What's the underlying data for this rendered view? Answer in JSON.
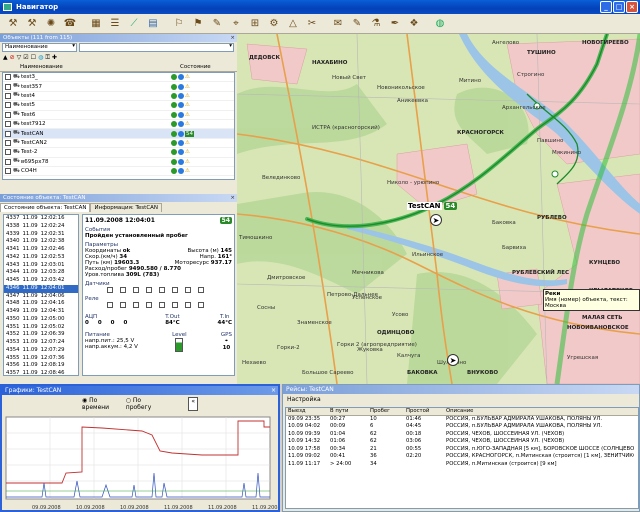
{
  "window": {
    "title": "Навигатор"
  },
  "objects_panel": {
    "title": "Объекты (111 from 115)",
    "filter_field": "Наименование",
    "col_name": "Наименование",
    "col_state": "Состояние",
    "rows": [
      {
        "name": "test3_",
        "state": "green-yellow"
      },
      {
        "name": "test357",
        "state": "green-yellow"
      },
      {
        "name": "test4",
        "state": "green-yellow"
      },
      {
        "name": "test5",
        "state": "green-yellow"
      },
      {
        "name": "Test6",
        "state": "green-yellow"
      },
      {
        "name": "test7912",
        "state": "green-yellow"
      },
      {
        "name": "TestCAN",
        "state": "green-54"
      },
      {
        "name": "TestCAN2",
        "state": "green-yellow"
      },
      {
        "name": "Test-2",
        "state": "green-yellow"
      },
      {
        "name": "в695рх78",
        "state": "green-yellow"
      },
      {
        "name": "CO4H",
        "state": "green-yellow"
      }
    ]
  },
  "state_panel": {
    "title": "Состояние объекта: TestCAN",
    "tab_state": "Состояние объекта: TestCAN",
    "tab_info": "Информация: TestCAN",
    "timestamp": "11.09.2008 12:04:01",
    "badge": "54",
    "events": [
      {
        "id": "4337",
        "date": "11.09",
        "time": "12:02:16"
      },
      {
        "id": "4338",
        "date": "11.09",
        "time": "12:02:24"
      },
      {
        "id": "4339",
        "date": "11.09",
        "time": "12:02:31"
      },
      {
        "id": "4340",
        "date": "11.09",
        "time": "12:02:38"
      },
      {
        "id": "4341",
        "date": "11.09",
        "time": "12:02:46"
      },
      {
        "id": "4342",
        "date": "11.09",
        "time": "12:02:53"
      },
      {
        "id": "4343",
        "date": "11.09",
        "time": "12:03:01"
      },
      {
        "id": "4344",
        "date": "11.09",
        "time": "12:03:28"
      },
      {
        "id": "4345",
        "date": "11.09",
        "time": "12:03:42"
      },
      {
        "id": "4346",
        "date": "11.09",
        "time": "12:04:01"
      },
      {
        "id": "4347",
        "date": "11.09",
        "time": "12:04:06"
      },
      {
        "id": "4348",
        "date": "11.09",
        "time": "12:04:16"
      },
      {
        "id": "4349",
        "date": "11.09",
        "time": "12:04:31"
      },
      {
        "id": "4350",
        "date": "11.09",
        "time": "12:05:00"
      },
      {
        "id": "4351",
        "date": "11.09",
        "time": "12:05:02"
      },
      {
        "id": "4352",
        "date": "11.09",
        "time": "12:06:39"
      },
      {
        "id": "4353",
        "date": "11.09",
        "time": "12:07:24"
      },
      {
        "id": "4354",
        "date": "11.09",
        "time": "12:07:29"
      },
      {
        "id": "4355",
        "date": "11.09",
        "time": "12:07:36"
      },
      {
        "id": "4356",
        "date": "11.09",
        "time": "12:08:19"
      },
      {
        "id": "4357",
        "date": "11.09",
        "time": "12:08:46"
      }
    ],
    "event_label": "События",
    "event_value": "Пройден установленный пробег",
    "params_label": "Параметры",
    "coords_label": "Координаты",
    "coords_value": "ok",
    "height_label": "Высота (м)",
    "height_value": "145",
    "speed_label": "Скор.(км/ч)",
    "speed_value": "34",
    "dir_label": "Напр.",
    "dir_value": "161°",
    "path_label": "Путь (км)",
    "path_value": "19603.3",
    "motor_label": "Моторесурс",
    "motor_value": "937.17",
    "fuel_label": "Расход/пробег",
    "fuel_value": "9490.580 / 8.770",
    "fuel_level_label": "Уров.топлива",
    "fuel_level_value": "309L (783)",
    "sensors_label": "Датчики",
    "relay_label": "Реле",
    "adc_label": "АЦП",
    "adc_values": [
      "0",
      "0",
      "0",
      "0"
    ],
    "tout_label": "T.Out",
    "tout_value": "84°C",
    "tin_label": "T.In",
    "tin_value": "44°C",
    "power_label": "Питание",
    "level_label": "Level",
    "gps_label": "GPS",
    "gps_value": "10",
    "supply_label": "напр.пит.:",
    "supply_value": "25,5 V",
    "battery_label": "напр.аккум.:",
    "battery_value": "4,2 V"
  },
  "map": {
    "object_label": "TestCAN",
    "object_badge": "54",
    "tooltip_title": "Реки",
    "tooltip_text": "Имя (номер) объекта, текст: Москва",
    "places": [
      "ДЕДОВСК",
      "НАХАБИНО",
      "Новый Свет",
      "Новоникольское",
      "Аникеевка",
      "ИСТРА (красногорский)",
      "КРАСНОГОРСК",
      "Николо - урюпино",
      "Велединково",
      "Тимошкино",
      "Ильинское",
      "Архангельское",
      "РУБЛЕВО",
      "Дмитровское",
      "Мечникова",
      "Успенское",
      "Знаменское",
      "Горки-2",
      "Усово",
      "Барвиха",
      "ОДИНЦОВО",
      "Немчиново",
      "Жуковка",
      "Калчуга",
      "БАКОВКА",
      "Шульгино",
      "НОВОИВАНОВСКОЕ",
      "НОВОГИРЕЕВО",
      "Угрешская",
      "МАЛАЯ СЕТЬ",
      "КУНЦЕВО",
      "КРЫЛАТСКОЕ",
      "Мякинино",
      "Павшино",
      "Ангелово",
      "ТУШИНО",
      "Строгино",
      "Баковка",
      "Митино",
      "Большое Сареево",
      "Нехаево",
      "РУБЛЕВСКИЙ ЛЕС",
      "Петрово-Дальнее",
      "Сосны",
      "Горки 2 (агропредприятие)",
      "ВНУКОВО"
    ]
  },
  "graph_panel": {
    "title": "Графики: TestCAN",
    "radio_time": "По времени",
    "radio_mileage": "По пробегу",
    "x_labels": [
      "09.09.2008",
      "10.09.2008",
      "10.09.2008",
      "11.09.2008",
      "11.09.2008",
      "11.09.2008"
    ]
  },
  "trips_panel": {
    "title": "Рейсы: TestCAN",
    "settings": "Настройка",
    "columns": [
      "Выезд",
      "В пути",
      "Пробег",
      "Простой",
      "Описание"
    ],
    "rows": [
      [
        "09.09 23:35",
        "00:27",
        "10",
        "01:46",
        "РОССИЯ, п.БУЛЬВАР АДМИРАЛА УШАКОВА, ПОЛЯНЫ УЛ."
      ],
      [
        "10.09 04:02",
        "00:09",
        "6",
        "04:45",
        "РОССИЯ, п.БУЛЬВАР АДМИРАЛА УШАКОВА, ПОЛЯНЫ УЛ."
      ],
      [
        "10.09 09:39",
        "01:04",
        "62",
        "00:18",
        "РОССИЯ, ЧЕХОВ, ШОССЕЙНАЯ УЛ. (ЧЕХОВ)"
      ],
      [
        "10.09 14:32",
        "01:06",
        "62",
        "03:06",
        "РОССИЯ, ЧЕХОВ, ШОССЕЙНАЯ УЛ. (ЧЕХОВ)"
      ],
      [
        "10.09 17:58",
        "00:34",
        "21",
        "00:55",
        "РОССИЯ, п.ЮГО-ЗАПАДНАЯ [5 км], БОРОВСКОЕ ШОССЕ (СОЛНЦЕВО)"
      ],
      [
        "11.09 09:02",
        "00:41",
        "36",
        "02:20",
        "РОССИЯ, КРАСНОГОРСК, п.Митинская (строится) [1 км], ЗЕНИТЧИКОВ УЛ."
      ],
      [
        "11.09 11:17",
        "> 24:00",
        "34",
        "",
        "РОССИЯ, п.Митинская (строится) [9 км]"
      ]
    ]
  }
}
